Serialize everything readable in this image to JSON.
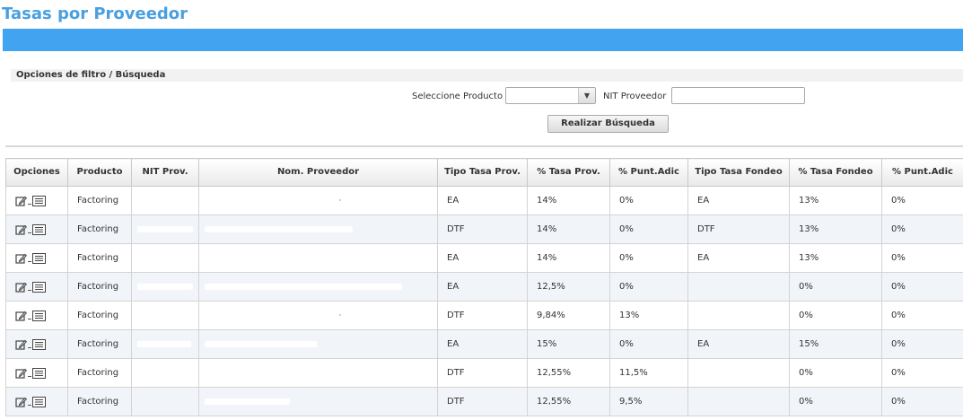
{
  "page": {
    "title": "Tasas por Proveedor"
  },
  "filter": {
    "section_title": "Opciones de filtro / Búsqueda",
    "product_label": "Seleccione Producto",
    "product_value": "",
    "nit_label": "NIT Proveedor",
    "nit_value": "",
    "search_button": "Realizar Búsqueda"
  },
  "table": {
    "headers": [
      "Opciones",
      "Producto",
      "NIT Prov.",
      "Nom. Proveedor",
      "Tipo Tasa Prov.",
      "% Tasa Prov.",
      "% Punt.Adic",
      "Tipo Tasa Fondeo",
      "% Tasa Fondeo",
      "% Punt.Adic"
    ],
    "rows": [
      {
        "producto": "Factoring",
        "tipo_tasa_prov": "EA",
        "tasa_prov": "14%",
        "punt_adic": "0%",
        "tipo_tasa_fondeo": "EA",
        "tasa_fondeo": "13%",
        "punt_adic_fondeo": "0%"
      },
      {
        "producto": "Factoring",
        "tipo_tasa_prov": "DTF",
        "tasa_prov": "14%",
        "punt_adic": "0%",
        "tipo_tasa_fondeo": "DTF",
        "tasa_fondeo": "13%",
        "punt_adic_fondeo": "0%"
      },
      {
        "producto": "Factoring",
        "tipo_tasa_prov": "EA",
        "tasa_prov": "14%",
        "punt_adic": "0%",
        "tipo_tasa_fondeo": "EA",
        "tasa_fondeo": "13%",
        "punt_adic_fondeo": "0%"
      },
      {
        "producto": "Factoring",
        "tipo_tasa_prov": "EA",
        "tasa_prov": "12,5%",
        "punt_adic": "0%",
        "tipo_tasa_fondeo": "",
        "tasa_fondeo": "0%",
        "punt_adic_fondeo": "0%"
      },
      {
        "producto": "Factoring",
        "tipo_tasa_prov": "DTF",
        "tasa_prov": "9,84%",
        "punt_adic": "13%",
        "tipo_tasa_fondeo": "",
        "tasa_fondeo": "0%",
        "punt_adic_fondeo": "0%"
      },
      {
        "producto": "Factoring",
        "tipo_tasa_prov": "EA",
        "tasa_prov": "15%",
        "punt_adic": "0%",
        "tipo_tasa_fondeo": "EA",
        "tasa_fondeo": "15%",
        "punt_adic_fondeo": "0%"
      },
      {
        "producto": "Factoring",
        "tipo_tasa_prov": "DTF",
        "tasa_prov": "12,55%",
        "punt_adic": "11,5%",
        "tipo_tasa_fondeo": "",
        "tasa_fondeo": "0%",
        "punt_adic_fondeo": "0%"
      },
      {
        "producto": "Factoring",
        "tipo_tasa_prov": "DTF",
        "tasa_prov": "12,55%",
        "punt_adic": "9,5%",
        "tipo_tasa_fondeo": "",
        "tasa_fondeo": "0%",
        "punt_adic_fondeo": "0%"
      }
    ]
  },
  "icons": {
    "edit": "edit-icon",
    "detail": "list-detail-icon",
    "dropdown": "chevron-down-icon"
  },
  "colors": {
    "title": "#4a9fe0",
    "bar": "#42a3f1",
    "row_alt": "#f1f5fa"
  }
}
